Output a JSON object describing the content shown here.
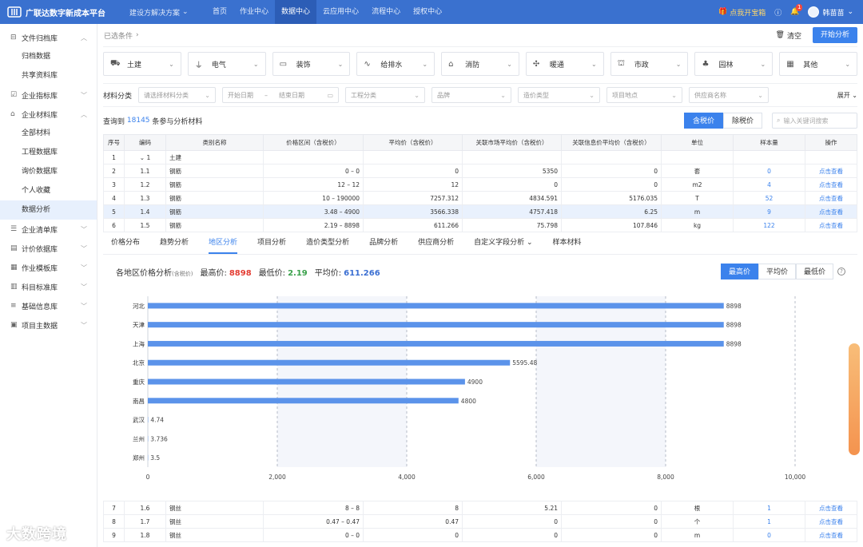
{
  "topnav": {
    "brand": "广联达数字新成本平台",
    "solutions": "建设方解决方案",
    "menu": [
      "首页",
      "作业中心",
      "数据中心",
      "云应用中心",
      "流程中心",
      "授权中心"
    ],
    "active_menu": 2,
    "treasure": "点我开宝箱",
    "notify_count": "1",
    "user": "韩苗苗"
  },
  "sidebar": [
    {
      "label": "文件归档库",
      "icon": "archive-icon",
      "expanded": true,
      "children": [
        "归档数据",
        "共享资料库"
      ]
    },
    {
      "label": "企业指标库",
      "icon": "checkbox-icon",
      "expanded": false,
      "children": []
    },
    {
      "label": "企业材料库",
      "icon": "building-icon",
      "expanded": true,
      "children": [
        "全部材料",
        "工程数据库",
        "询价数据库",
        "个人收藏",
        "数据分析"
      ]
    },
    {
      "label": "企业清单库",
      "icon": "list-icon",
      "expanded": false,
      "children": []
    },
    {
      "label": "计价依据库",
      "icon": "doc-icon",
      "expanded": false,
      "children": []
    },
    {
      "label": "作业模板库",
      "icon": "template-icon",
      "expanded": false,
      "children": []
    },
    {
      "label": "科目标准库",
      "icon": "table-icon",
      "expanded": false,
      "children": []
    },
    {
      "label": "基础信息库",
      "icon": "menu-icon",
      "expanded": false,
      "children": []
    },
    {
      "label": "项目主数据",
      "icon": "project-icon",
      "expanded": false,
      "children": []
    }
  ],
  "sidebar_active": "数据分析",
  "condbar": {
    "label": "已选条件",
    "clear": "清空",
    "start": "开始分析"
  },
  "categories": [
    {
      "label": "土建",
      "icon": "excavator-icon"
    },
    {
      "label": "电气",
      "icon": "plug-icon"
    },
    {
      "label": "装饰",
      "icon": "paint-roller-icon"
    },
    {
      "label": "给排水",
      "icon": "pipe-icon"
    },
    {
      "label": "消防",
      "icon": "fire-station-icon"
    },
    {
      "label": "暖通",
      "icon": "fan-icon"
    },
    {
      "label": "市政",
      "icon": "municipal-icon"
    },
    {
      "label": "园林",
      "icon": "tree-icon"
    },
    {
      "label": "其他",
      "icon": "grid-icon"
    }
  ],
  "filters": {
    "label": "材料分类",
    "material": "请选择材料分类",
    "start_date": "开始日期",
    "end_date": "结束日期",
    "project_class": "工程分类",
    "brand": "品牌",
    "cost_type": "造价类型",
    "location": "项目地点",
    "supplier": "供应商名称",
    "expand": "展开"
  },
  "countbar": {
    "prefix": "查询到",
    "count": "18145",
    "suffix": "条参与分析材料",
    "tax_in": "含税价",
    "tax_out": "除税价",
    "search_placeholder": "输入关键词搜索"
  },
  "table": {
    "headers": [
      "序号",
      "编码",
      "类别名称",
      "价格区间（含税价）",
      "平均价（含税价）",
      "关联市场平均价（含税价）",
      "关联信息价平均价（含税价）",
      "单位",
      "样本量",
      "操作"
    ],
    "group_row": {
      "no": "1",
      "code": "1",
      "name": "土建"
    },
    "rows": [
      {
        "no": "2",
        "code": "1.1",
        "name": "钢筋",
        "range": "0 – 0",
        "avg": "0",
        "market": "5350",
        "info": "0",
        "unit": "套",
        "samples": "0",
        "op": "点击查看"
      },
      {
        "no": "3",
        "code": "1.2",
        "name": "钢筋",
        "range": "12 – 12",
        "avg": "12",
        "market": "0",
        "info": "0",
        "unit": "m2",
        "samples": "4",
        "op": "点击查看"
      },
      {
        "no": "4",
        "code": "1.3",
        "name": "钢筋",
        "range": "10 – 190000",
        "avg": "7257.312",
        "market": "4834.591",
        "info": "5176.035",
        "unit": "T",
        "samples": "52",
        "op": "点击查看"
      },
      {
        "no": "5",
        "code": "1.4",
        "name": "钢筋",
        "range": "3.48 – 4900",
        "avg": "3566.338",
        "market": "4757.418",
        "info": "6.25",
        "unit": "m",
        "samples": "9",
        "op": "点击查看"
      },
      {
        "no": "6",
        "code": "1.5",
        "name": "钢筋",
        "range": "2.19 – 8898",
        "avg": "611.266",
        "market": "75.798",
        "info": "107.846",
        "unit": "kg",
        "samples": "122",
        "op": "点击查看"
      }
    ],
    "bottom_rows": [
      {
        "no": "7",
        "code": "1.6",
        "name": "钢丝",
        "range": "8 – 8",
        "avg": "8",
        "market": "5.21",
        "info": "0",
        "unit": "根",
        "samples": "1",
        "op": "点击查看"
      },
      {
        "no": "8",
        "code": "1.7",
        "name": "钢丝",
        "range": "0.47 – 0.47",
        "avg": "0.47",
        "market": "0",
        "info": "0",
        "unit": "个",
        "samples": "1",
        "op": "点击查看"
      },
      {
        "no": "9",
        "code": "1.8",
        "name": "钢丝",
        "range": "0 – 0",
        "avg": "0",
        "market": "0",
        "info": "0",
        "unit": "m",
        "samples": "0",
        "op": "点击查看"
      }
    ]
  },
  "analysis_tabs": [
    "价格分布",
    "趋势分析",
    "地区分析",
    "项目分析",
    "造价类型分析",
    "品牌分析",
    "供应商分析",
    "自定义字段分析",
    "样本材料"
  ],
  "analysis_active": 2,
  "chart_head": {
    "title": "各地区价格分析",
    "title_note": "(含税价)",
    "max_label": "最高价:",
    "max": "8898",
    "min_label": "最低价:",
    "min": "2.19",
    "avg_label": "平均价:",
    "avg": "611.266"
  },
  "chart_seg": [
    "最高价",
    "平均价",
    "最低价"
  ],
  "chart_data": {
    "type": "bar",
    "orientation": "horizontal",
    "categories": [
      "河北",
      "天津",
      "上海",
      "北京",
      "重庆",
      "南昌",
      "武汉",
      "兰州",
      "郑州"
    ],
    "values": [
      8898,
      8898,
      8898,
      5595.48,
      4900,
      4800,
      4.74,
      3.736,
      3.5
    ],
    "value_labels": [
      "8898",
      "8898",
      "8898",
      "5595.48",
      "4900",
      "4800",
      "4.74",
      "3.736",
      "3.5"
    ],
    "xlim": [
      0,
      10000
    ],
    "xticks": [
      "0",
      "2,000",
      "4,000",
      "6,000",
      "8,000",
      "10,000"
    ],
    "color": "#5b93ea",
    "grid": "vertical dashed"
  },
  "watermark": "大数跨境"
}
